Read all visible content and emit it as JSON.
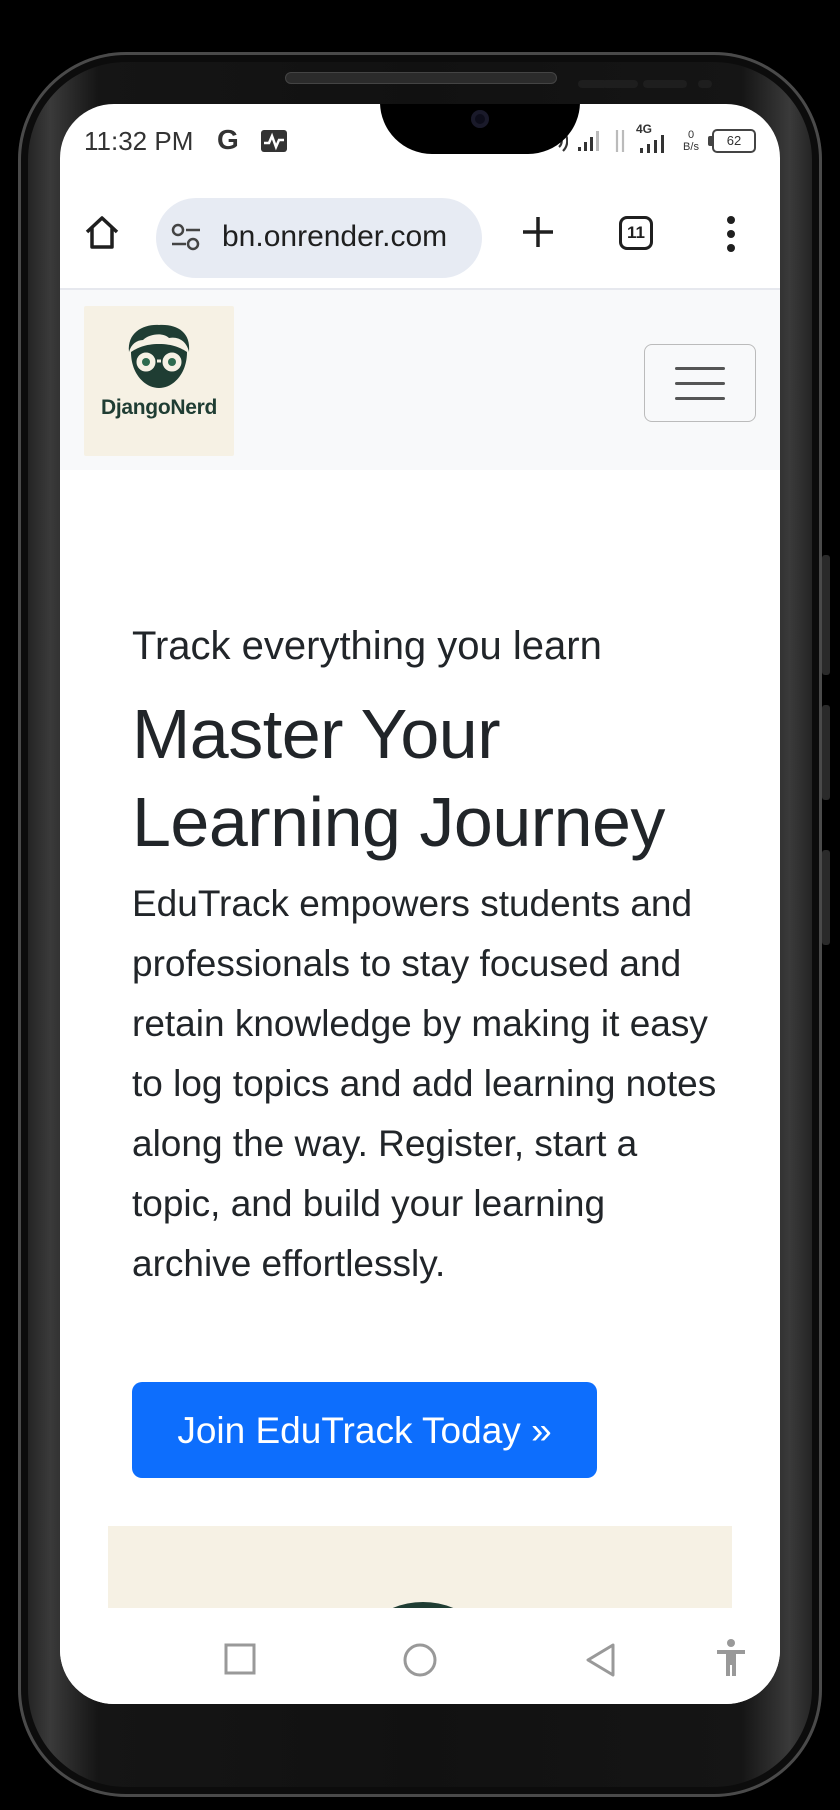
{
  "status_bar": {
    "time": "11:32 PM",
    "carrier_icon": "G",
    "net_speed_value": "0",
    "net_speed_unit": "B/s",
    "network_type": "4G",
    "battery": "62"
  },
  "browser": {
    "url": "bn.onrender.com",
    "tab_count": "11"
  },
  "site": {
    "brand": "DjangoNerd",
    "hero": {
      "subtitle": "Track everything you learn",
      "title": "Master Your Learning Journey",
      "lead": "EduTrack empowers students and professionals to stay focused and retain knowledge by making it easy to log topics and add learning notes along the way. Register, start a topic, and build your learning archive effortlessly.",
      "cta": "Join EduTrack Today »"
    }
  },
  "colors": {
    "primary": "#0d6efd",
    "brand_dark": "#1f3d33",
    "logo_bg": "#f6f1e4",
    "nav_bg": "#f8f9fa"
  }
}
